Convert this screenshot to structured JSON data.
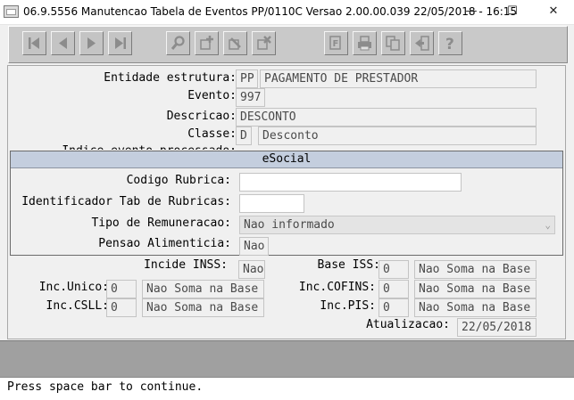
{
  "window": {
    "title": "06.9.5556 Manutencao  Tabela de Eventos PP/0110C Versao 2.00.00.039 22/05/2018 - 16:15",
    "minimize": "—",
    "maximize": "☐",
    "close": "✕"
  },
  "toolbar": {
    "buttons": [
      "first-record",
      "previous-record",
      "next-record",
      "last-record",
      "search",
      "insert",
      "edit",
      "delete",
      "filter",
      "print",
      "copy",
      "exit",
      "help"
    ]
  },
  "form": {
    "entidade_label": "Entidade estrutura:",
    "entidade_code": "PP",
    "entidade_name": "PAGAMENTO DE PRESTADOR",
    "evento_label": "Evento:",
    "evento_value": "997",
    "descricao_label": "Descricao:",
    "descricao_value": "DESCONTO",
    "classe_label": "Classe:",
    "classe_code": "D",
    "classe_name": "Desconto",
    "hidden_label": "Indice evento processado:",
    "incide_inss_label": "Incide INSS:",
    "incide_inss_value": "Nao",
    "base_iss_label": "Base ISS:",
    "base_iss_code": "0",
    "base_iss_name": "Nao Soma na Base",
    "inc_unico_label": "Inc.Unico:",
    "inc_unico_code": "0",
    "inc_unico_name": "Nao Soma na Base",
    "inc_cofins_label": "Inc.COFINS:",
    "inc_cofins_code": "0",
    "inc_cofins_name": "Nao Soma na Base",
    "inc_csll_label": "Inc.CSLL:",
    "inc_csll_code": "0",
    "inc_csll_name": "Nao Soma na Base",
    "inc_pis_label": "Inc.PIS:",
    "inc_pis_code": "0",
    "inc_pis_name": "Nao Soma na Base",
    "atualizacao_label": "Atualizacao:",
    "atualizacao_value": "22/05/2018"
  },
  "esocial": {
    "title": "eSocial",
    "codigo_rubrica_label": "Codigo Rubrica:",
    "codigo_rubrica_value": "",
    "identificador_label": "Identificador Tab de Rubricas:",
    "identificador_value": "",
    "tipo_remuneracao_label": "Tipo de Remuneracao:",
    "tipo_remuneracao_value": "Nao informado",
    "pensao_label": "Pensao Alimenticia:",
    "pensao_value": "Nao"
  },
  "status": {
    "message": "Press space bar to continue."
  }
}
